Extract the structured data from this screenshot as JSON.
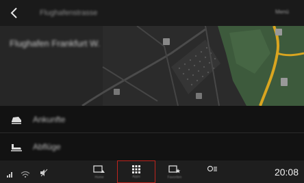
{
  "header": {
    "title": "Flughafenstrasse",
    "action": "Menü"
  },
  "map": {
    "location_label": "Flughafen Frankfurt W."
  },
  "list": {
    "items": [
      {
        "label": "Ankunfte",
        "icon": "car-arrival-icon"
      },
      {
        "label": "Abflüge",
        "icon": "departure-icon"
      }
    ]
  },
  "bottombar": {
    "status_icons": [
      "signal-icon",
      "wifi-icon",
      "mute-icon"
    ],
    "buttons": [
      {
        "name": "home-screen",
        "sub": "Home"
      },
      {
        "name": "apps",
        "sub": "Apps"
      },
      {
        "name": "favorites",
        "sub": "Favoriten"
      },
      {
        "name": "settings",
        "sub": ""
      }
    ],
    "clock": "20:08"
  },
  "colors": {
    "accent": "#c0241e",
    "road_yellow": "#d9a520",
    "park_green": "#3d5a3c",
    "map_dark": "#2f2f2f"
  }
}
